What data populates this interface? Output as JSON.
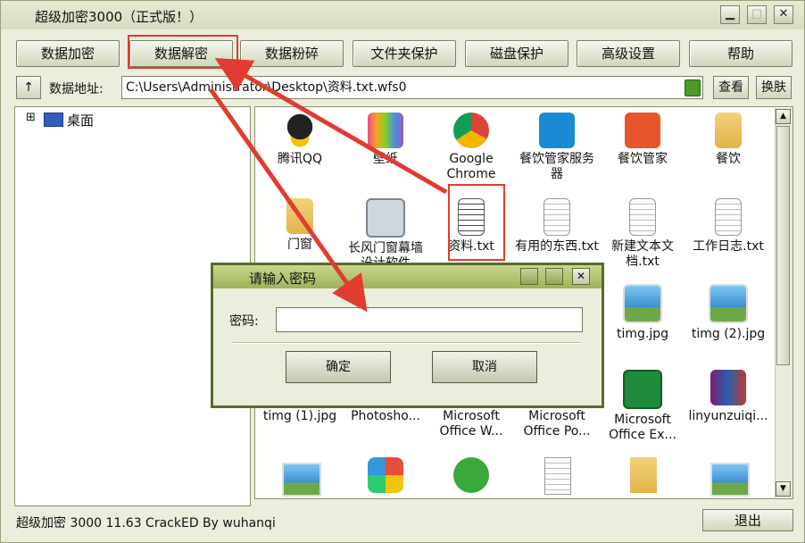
{
  "window": {
    "title": "超级加密3000（正式版！）"
  },
  "toolbar": [
    {
      "label": "数据加密"
    },
    {
      "label": "数据解密"
    },
    {
      "label": "数据粉碎"
    },
    {
      "label": "文件夹保护"
    },
    {
      "label": "磁盘保护"
    },
    {
      "label": "高级设置"
    },
    {
      "label": "帮助"
    }
  ],
  "address": {
    "up_symbol": "↑",
    "label": "数据地址:",
    "value": "C:\\Users\\Administrator\\Desktop\\资料.txt.wfs0",
    "view_button": "查看",
    "skin_button": "换肤"
  },
  "tree": {
    "root_label": "桌面",
    "expander": "⊞"
  },
  "files": [
    {
      "name": "腾讯QQ",
      "icon": "qq-icon"
    },
    {
      "name": "壁纸",
      "icon": "wallpaper-icon"
    },
    {
      "name": "Google Chrome",
      "icon": "chrome-icon"
    },
    {
      "name": "餐饮管家服务器",
      "icon": "catering-server-icon"
    },
    {
      "name": "餐饮管家",
      "icon": "catering-icon"
    },
    {
      "name": "餐饮",
      "icon": "folder-icon"
    },
    {
      "name": "门窗",
      "icon": "folder-icon"
    },
    {
      "name": "长风门窗幕墙设计软件",
      "icon": "app-icon"
    },
    {
      "name": "资料.txt",
      "icon": "txt-icon"
    },
    {
      "name": "有用的东西.txt",
      "icon": "txt-icon"
    },
    {
      "name": "新建文本文档.txt",
      "icon": "txt-icon"
    },
    {
      "name": "工作日志.txt",
      "icon": "txt-icon"
    },
    {
      "name": "timg.jpg",
      "icon": "image-icon"
    },
    {
      "name": "timg (2).jpg",
      "icon": "image-icon"
    },
    {
      "name": "timg (1).jpg",
      "icon": "image-icon"
    },
    {
      "name": "Photosho...",
      "icon": "photoshop-icon"
    },
    {
      "name": "Microsoft Office W...",
      "icon": "word-icon"
    },
    {
      "name": "Microsoft Office Po...",
      "icon": "powerpoint-icon"
    },
    {
      "name": "Microsoft Office Ex...",
      "icon": "excel-icon"
    },
    {
      "name": "linyunzuiqi...",
      "icon": "winrar-icon"
    }
  ],
  "dialog": {
    "title": "请输入密码",
    "password_label": "密码:",
    "password_value": "",
    "ok_label": "确定",
    "cancel_label": "取消",
    "close_symbol": "✕"
  },
  "status": {
    "text": "超级加密 3000 11.63  CrackED By wuhanqi",
    "exit_label": "退出"
  },
  "colors": {
    "window_bg": "#eceedd",
    "dialog_border": "#556d2a",
    "annotation": "#e23b30"
  }
}
